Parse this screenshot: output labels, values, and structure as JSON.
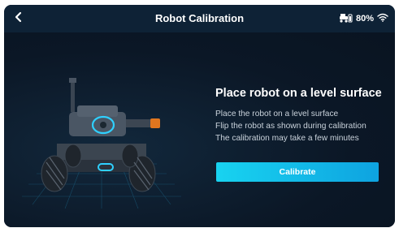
{
  "header": {
    "title": "Robot Calibration",
    "back_icon": "chevron-left-icon",
    "battery_icon": "robot-battery-icon",
    "battery_level": "80%",
    "wifi_icon": "wifi-icon"
  },
  "main": {
    "robot_image": "robot-illustration",
    "heading": "Place robot on a level surface",
    "instructions": [
      "Place the robot on a level surface",
      "Flip the robot as shown during calibration",
      "The calibration may take a few minutes"
    ],
    "calibrate_label": "Calibrate"
  },
  "colors": {
    "topbar": "#0e2236",
    "background": "#0b1726",
    "accent": "#18d3f0",
    "indicator": "#2fd0ff"
  }
}
